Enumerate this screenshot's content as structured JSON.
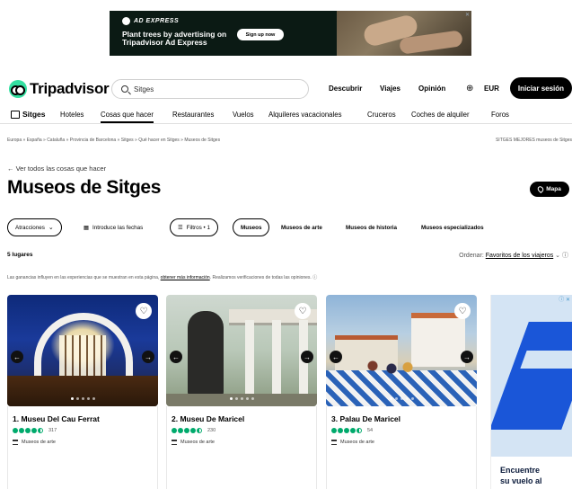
{
  "ad_banner": {
    "brand": "AD EXPRESS",
    "headline": "Plant trees by advertising on Tripadvisor Ad Express",
    "cta": "Sign up now",
    "close": "✕"
  },
  "header": {
    "logo_text": "Tripadvisor",
    "search_value": "Sitges",
    "nav": [
      "Descubrir",
      "Viajes",
      "Opinión"
    ],
    "currency": "EUR",
    "signin_label": "Iniciar sesión"
  },
  "category_nav": {
    "home_label": "Sitges",
    "items": [
      "Hoteles",
      "Cosas que hacer",
      "Restaurantes",
      "Vuelos",
      "Alquileres vacacionales",
      "Cruceros",
      "Coches de alquiler",
      "Foros"
    ]
  },
  "breadcrumb": {
    "path": "Europa » España » Cataluña » Provincia de Barcelona » Sitges » Qué hacer en Sitges » Museos de Sitges",
    "right": "SITGES MEJORES museos de Sitges"
  },
  "back_link": "← Ver todos las cosas que hacer",
  "page_title": "Museos de Sitges",
  "map_button": "Mapa",
  "chips": [
    {
      "label": "Atracciones",
      "chevron": "⌄"
    },
    {
      "label": "Introduce las fechas",
      "icon": "▦"
    },
    {
      "label": "Filtros • 1",
      "icon": "☰"
    },
    {
      "label": "Museos"
    },
    {
      "label": "Museos de arte"
    },
    {
      "label": "Museos de historia"
    },
    {
      "label": "Museos especializados"
    }
  ],
  "results_count": "5 lugares",
  "sort": {
    "prefix": "Ordenar:",
    "value": "Favoritos de los viajeros",
    "chevron": "⌄"
  },
  "disclaimer": {
    "text": "Las ganancias influyen en las experiencias que se muestran en esta página,",
    "link": "obtener más información",
    "rest": ". Realizamos verificaciones de todas las opiniones."
  },
  "cards": [
    {
      "title": "1. Museu Del Cau Ferrat",
      "rating": 4.5,
      "reviews": "317",
      "category": "Museos de arte"
    },
    {
      "title": "2. Museu De Maricel",
      "rating": 4.5,
      "reviews": "230",
      "category": "Museos de arte"
    },
    {
      "title": "3. Palau De Maricel",
      "rating": 4.5,
      "reviews": "54",
      "category": "Museos de arte"
    }
  ],
  "side_ad": {
    "line1": "Encuentre",
    "line2": "su vuelo al",
    "badge": "ⓘ ✕"
  },
  "icons": {
    "heart": "heart-icon",
    "search": "search-icon",
    "map": "map-pin-icon",
    "globe": "globe-icon"
  },
  "colors": {
    "brand_green": "#34e0a1",
    "rating_green": "#00aa6c",
    "ad_bg": "#0b1a14"
  }
}
